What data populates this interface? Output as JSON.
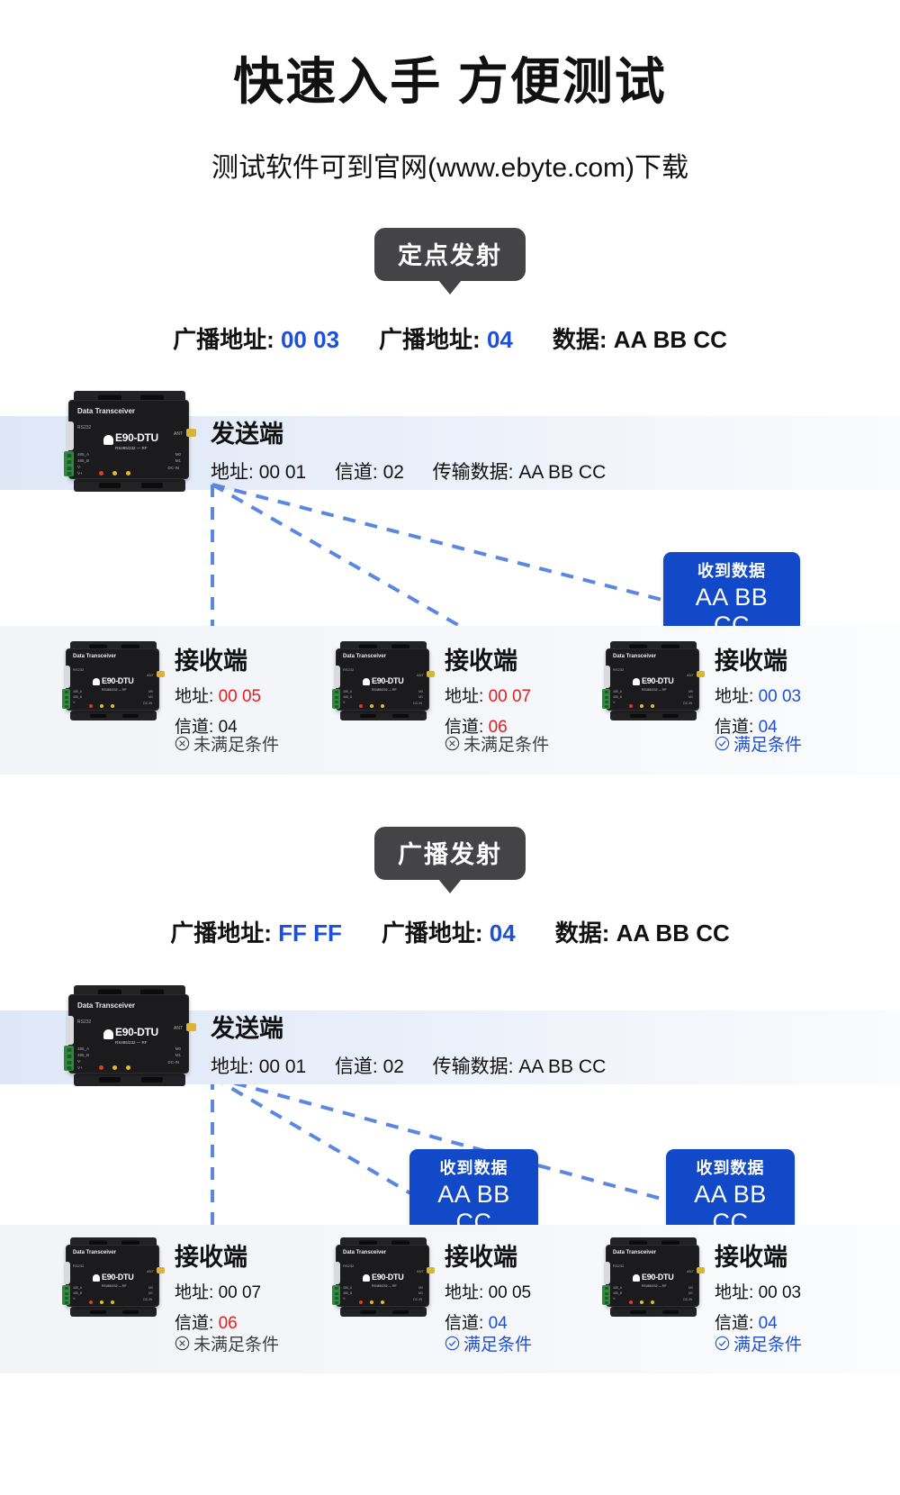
{
  "header": {
    "title": "快速入手 方便测试",
    "subtitle": "测试软件可到官网(www.ebyte.com)下载"
  },
  "colors": {
    "accent_blue": "#1d4fd8",
    "bubble_blue": "#1249c8",
    "bad_red": "#e02020",
    "badge_gray": "#444446"
  },
  "sections": [
    {
      "badge": "定点发射",
      "params": [
        {
          "key": "广播地址:",
          "value": "00 03",
          "value_color": "blue"
        },
        {
          "key": "广播地址:",
          "value": "04",
          "value_color": "blue"
        },
        {
          "key": "数据:",
          "value": "AA BB CC",
          "value_color": "dark"
        }
      ],
      "sender": {
        "title": "发送端",
        "addr_label": "地址:",
        "addr_value": "00 01",
        "chan_label": "信道:",
        "chan_value": "02",
        "data_label": "传输数据:",
        "data_value": "AA BB CC",
        "device_caption": "Data Transceiver",
        "device_model": "E90-DTU",
        "device_sub": "RS485/232 — RF",
        "device_port": "RS232",
        "device_ant": "ANT",
        "device_pins": [
          "485_A",
          "485_B",
          "V-",
          "V+"
        ],
        "device_mode": [
          "M0",
          "M1"
        ],
        "device_dc": "DC-IN",
        "device_leds": [
          "PWR",
          "TXD",
          "RXD"
        ]
      },
      "receivers": [
        {
          "title": "接收端",
          "addr_label": "地址:",
          "addr_value": "00 05",
          "addr_color": "red",
          "chan_label": "信道:",
          "chan_value": "04",
          "chan_color": "dark",
          "status": "未满足条件",
          "status_type": "bad",
          "status_icon": "circle-x-icon",
          "bubble": null
        },
        {
          "title": "接收端",
          "addr_label": "地址:",
          "addr_value": "00 07",
          "addr_color": "red",
          "chan_label": "信道:",
          "chan_value": "06",
          "chan_color": "red",
          "status": "未满足条件",
          "status_type": "bad",
          "status_icon": "circle-x-icon",
          "bubble": null
        },
        {
          "title": "接收端",
          "addr_label": "地址:",
          "addr_value": "00 03",
          "addr_color": "blue",
          "chan_label": "信道:",
          "chan_value": "04",
          "chan_color": "blue",
          "status": "满足条件",
          "status_type": "good",
          "status_icon": "circle-check-icon",
          "bubble": {
            "top": "收到数据",
            "data": "AA BB CC"
          }
        }
      ]
    },
    {
      "badge": "广播发射",
      "params": [
        {
          "key": "广播地址:",
          "value": "FF FF",
          "value_color": "blue"
        },
        {
          "key": "广播地址:",
          "value": "04",
          "value_color": "blue"
        },
        {
          "key": "数据:",
          "value": "AA BB CC",
          "value_color": "dark"
        }
      ],
      "sender": {
        "title": "发送端",
        "addr_label": "地址:",
        "addr_value": "00 01",
        "chan_label": "信道:",
        "chan_value": "02",
        "data_label": "传输数据:",
        "data_value": "AA BB CC",
        "device_caption": "Data Transceiver",
        "device_model": "E90-DTU",
        "device_sub": "RS485/232 — RF",
        "device_port": "RS232",
        "device_ant": "ANT",
        "device_pins": [
          "485_A",
          "485_B",
          "V-",
          "V+"
        ],
        "device_mode": [
          "M0",
          "M1"
        ],
        "device_dc": "DC-IN",
        "device_leds": [
          "PWR",
          "TXD",
          "RXD"
        ]
      },
      "receivers": [
        {
          "title": "接收端",
          "addr_label": "地址:",
          "addr_value": "00 07",
          "addr_color": "dark",
          "chan_label": "信道:",
          "chan_value": "06",
          "chan_color": "red",
          "status": "未满足条件",
          "status_type": "bad",
          "status_icon": "circle-x-icon",
          "bubble": null
        },
        {
          "title": "接收端",
          "addr_label": "地址:",
          "addr_value": "00 05",
          "addr_color": "dark",
          "chan_label": "信道:",
          "chan_value": "04",
          "chan_color": "blue",
          "status": "满足条件",
          "status_type": "good",
          "status_icon": "circle-check-icon",
          "bubble": {
            "top": "收到数据",
            "data": "AA BB CC"
          }
        },
        {
          "title": "接收端",
          "addr_label": "地址:",
          "addr_value": "00 03",
          "addr_color": "dark",
          "chan_label": "信道:",
          "chan_value": "04",
          "chan_color": "blue",
          "status": "满足条件",
          "status_type": "good",
          "status_icon": "circle-check-icon",
          "bubble": {
            "top": "收到数据",
            "data": "AA BB CC"
          }
        }
      ]
    }
  ]
}
